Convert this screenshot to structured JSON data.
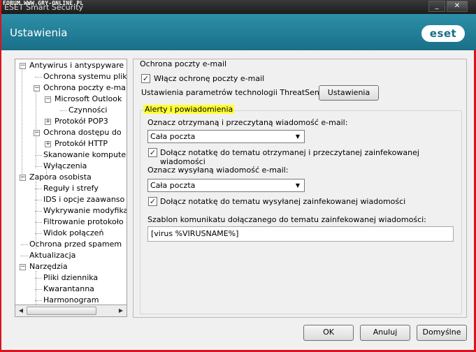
{
  "window": {
    "watermark": "FORUM WWW.GRY-ONLINE.PL",
    "app_title": "ESET Smart Security",
    "minimize": "_",
    "close": "✕"
  },
  "header": {
    "title": "Ustawienia",
    "logo": "eset"
  },
  "tree": {
    "items": [
      {
        "label": "Antywirus i antyspyware",
        "level": 0,
        "expander": "−"
      },
      {
        "label": "Ochrona systemu plik",
        "level": 1,
        "expander": ""
      },
      {
        "label": "Ochrona poczty e-ma",
        "level": 1,
        "expander": "−"
      },
      {
        "label": "Microsoft Outlook",
        "level": 2,
        "expander": "−"
      },
      {
        "label": "Czynności",
        "level": 3,
        "expander": ""
      },
      {
        "label": "Protokół POP3",
        "level": 2,
        "expander": "+"
      },
      {
        "label": "Ochrona dostępu do",
        "level": 1,
        "expander": "−"
      },
      {
        "label": "Protokół HTTP",
        "level": 2,
        "expander": "+"
      },
      {
        "label": "Skanowanie kompute",
        "level": 1,
        "expander": ""
      },
      {
        "label": "Wyłączenia",
        "level": 1,
        "expander": ""
      },
      {
        "label": "Zapora osobista",
        "level": 0,
        "expander": "−"
      },
      {
        "label": "Reguły i strefy",
        "level": 1,
        "expander": ""
      },
      {
        "label": "IDS i opcje zaawanso",
        "level": 1,
        "expander": ""
      },
      {
        "label": "Wykrywanie modyfika",
        "level": 1,
        "expander": ""
      },
      {
        "label": "Filtrowanie protokoło",
        "level": 1,
        "expander": ""
      },
      {
        "label": "Widok połączeń",
        "level": 1,
        "expander": ""
      },
      {
        "label": "Ochrona przed spamem",
        "level": 0,
        "expander": ""
      },
      {
        "label": "Aktualizacja",
        "level": 0,
        "expander": ""
      },
      {
        "label": "Narzędzia",
        "level": 0,
        "expander": "−"
      },
      {
        "label": "Pliki dziennika",
        "level": 1,
        "expander": ""
      },
      {
        "label": "Kwarantanna",
        "level": 1,
        "expander": ""
      },
      {
        "label": "Harmonogram",
        "level": 1,
        "expander": ""
      }
    ]
  },
  "main": {
    "section_title": "Ochrona poczty e-mail",
    "enable_label": "Włącz ochronę poczty e-mail",
    "enable_checked": true,
    "threatsense_label": "Ustawienia parametrów technologii ThreatSense:",
    "threatsense_button": "Ustawienia",
    "alerts_title": "Alerty i powiadomienia",
    "received_label": "Oznacz otrzymaną i przeczytaną wiadomość e-mail:",
    "received_value": "Cała poczta",
    "received_note_label": "Dołącz notatkę do tematu otrzymanej i przeczytanej zainfekowanej wiadomości",
    "received_note_checked": true,
    "sent_label": "Oznacz wysyłaną wiadomość e-mail:",
    "sent_value": "Cała poczta",
    "sent_note_label": "Dołącz notatkę do tematu wysyłanej zainfekowanej wiadomości",
    "sent_note_checked": true,
    "template_label": "Szablon komunikatu dołączanego do tematu zainfekowanej wiadomości:",
    "template_value": "[virus %VIRUSNAME%]"
  },
  "buttons": {
    "ok": "OK",
    "cancel": "Anuluj",
    "defaults": "Domyślne"
  },
  "colors": {
    "header": "#1a6f88",
    "border": "#d8141e",
    "highlight": "#ffff33"
  }
}
